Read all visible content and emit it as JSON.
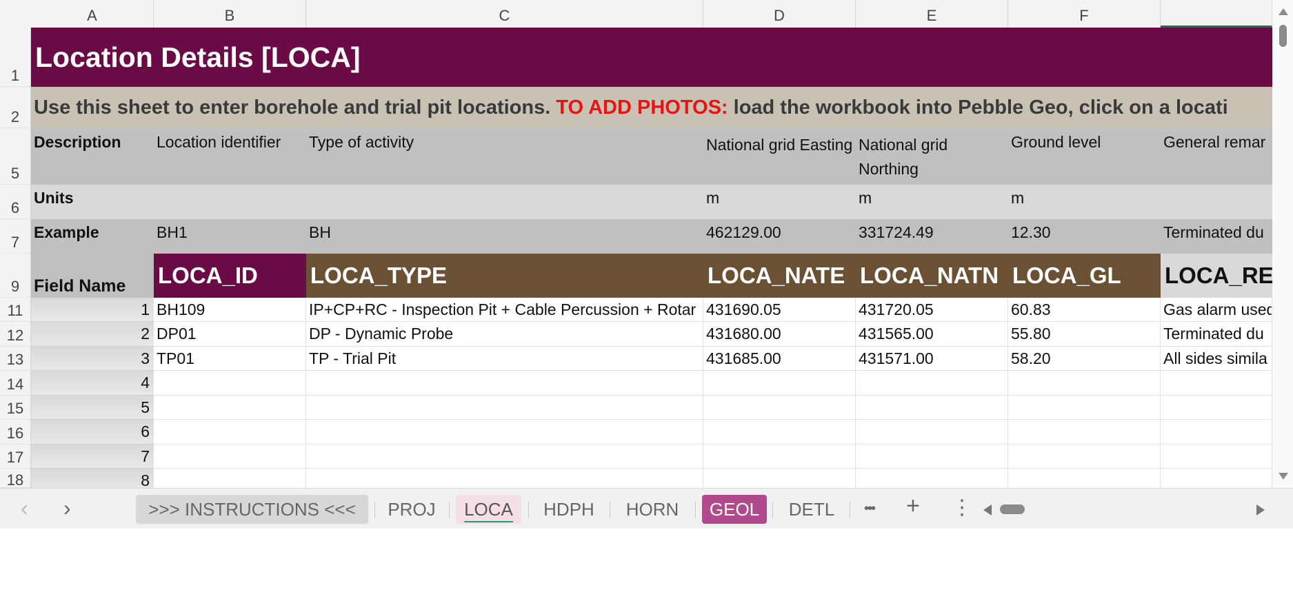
{
  "columns": [
    "A",
    "B",
    "C",
    "D",
    "E",
    "F",
    ""
  ],
  "row_numbers": [
    "1",
    "2",
    "5",
    "6",
    "7",
    "9",
    "11",
    "12",
    "13",
    "14",
    "15",
    "16",
    "17",
    "18"
  ],
  "title": "Location Details [LOCA]",
  "info": {
    "part1": "Use this sheet to enter borehole and trial pit locations. ",
    "highlight": "TO ADD PHOTOS:",
    "part2": " load the workbook into Pebble Geo, click on a locati"
  },
  "description_row": {
    "label": "Description",
    "cells": [
      "Location identifier",
      "Type of activity",
      "National grid Easting",
      "National grid Northing",
      "Ground level",
      "General remar"
    ]
  },
  "units_row": {
    "label": "Units",
    "cells": [
      "",
      "",
      "m",
      "m",
      "m",
      ""
    ]
  },
  "example_row": {
    "label": "Example",
    "cells": [
      "BH1",
      "BH",
      "462129.00",
      "331724.49",
      "12.30",
      "Terminated du"
    ]
  },
  "field_row": {
    "label": "Field Name",
    "cells": [
      "LOCA_ID",
      "LOCA_TYPE",
      "LOCA_NATE",
      "LOCA_NATN",
      "LOCA_GL",
      "LOCA_RE"
    ]
  },
  "data_rows": [
    {
      "idx": "1",
      "cells": [
        "BH109",
        "IP+CP+RC - Inspection Pit + Cable Percussion + Rotar",
        "431690.05",
        "431720.05",
        "60.83",
        "Gas alarm used"
      ]
    },
    {
      "idx": "2",
      "cells": [
        "DP01",
        "DP - Dynamic Probe",
        "431680.00",
        "431565.00",
        "55.80",
        "Terminated du"
      ]
    },
    {
      "idx": "3",
      "cells": [
        "TP01",
        "TP - Trial Pit",
        "431685.00",
        "431571.00",
        "58.20",
        "All sides simila"
      ]
    },
    {
      "idx": "4",
      "cells": [
        "",
        "",
        "",
        "",
        "",
        ""
      ]
    },
    {
      "idx": "5",
      "cells": [
        "",
        "",
        "",
        "",
        "",
        ""
      ]
    },
    {
      "idx": "6",
      "cells": [
        "",
        "",
        "",
        "",
        "",
        ""
      ]
    },
    {
      "idx": "7",
      "cells": [
        "",
        "",
        "",
        "",
        "",
        ""
      ]
    },
    {
      "idx": "8",
      "cells": [
        "",
        "",
        "",
        "",
        "",
        ""
      ]
    }
  ],
  "tabs": [
    {
      "label": ">>> INSTRUCTIONS <<<",
      "state": "instr"
    },
    {
      "label": "PROJ",
      "state": "normal"
    },
    {
      "label": "LOCA",
      "state": "active"
    },
    {
      "label": "HDPH",
      "state": "normal"
    },
    {
      "label": "HORN",
      "state": "normal"
    },
    {
      "label": "GEOL",
      "state": "highlight"
    },
    {
      "label": "DETL",
      "state": "normal"
    }
  ],
  "tab_tools": {
    "prev": "‹",
    "next": "›",
    "more": "•••",
    "add": "+",
    "options": "⋮"
  },
  "colors": {
    "title_band": "#6b0b45",
    "info_band": "#c8c2b4",
    "field_brown": "#6b5133",
    "highlight_text": "#ee1111",
    "active_tab": "#f4dfe9",
    "geol_tab": "#b04a8c"
  }
}
